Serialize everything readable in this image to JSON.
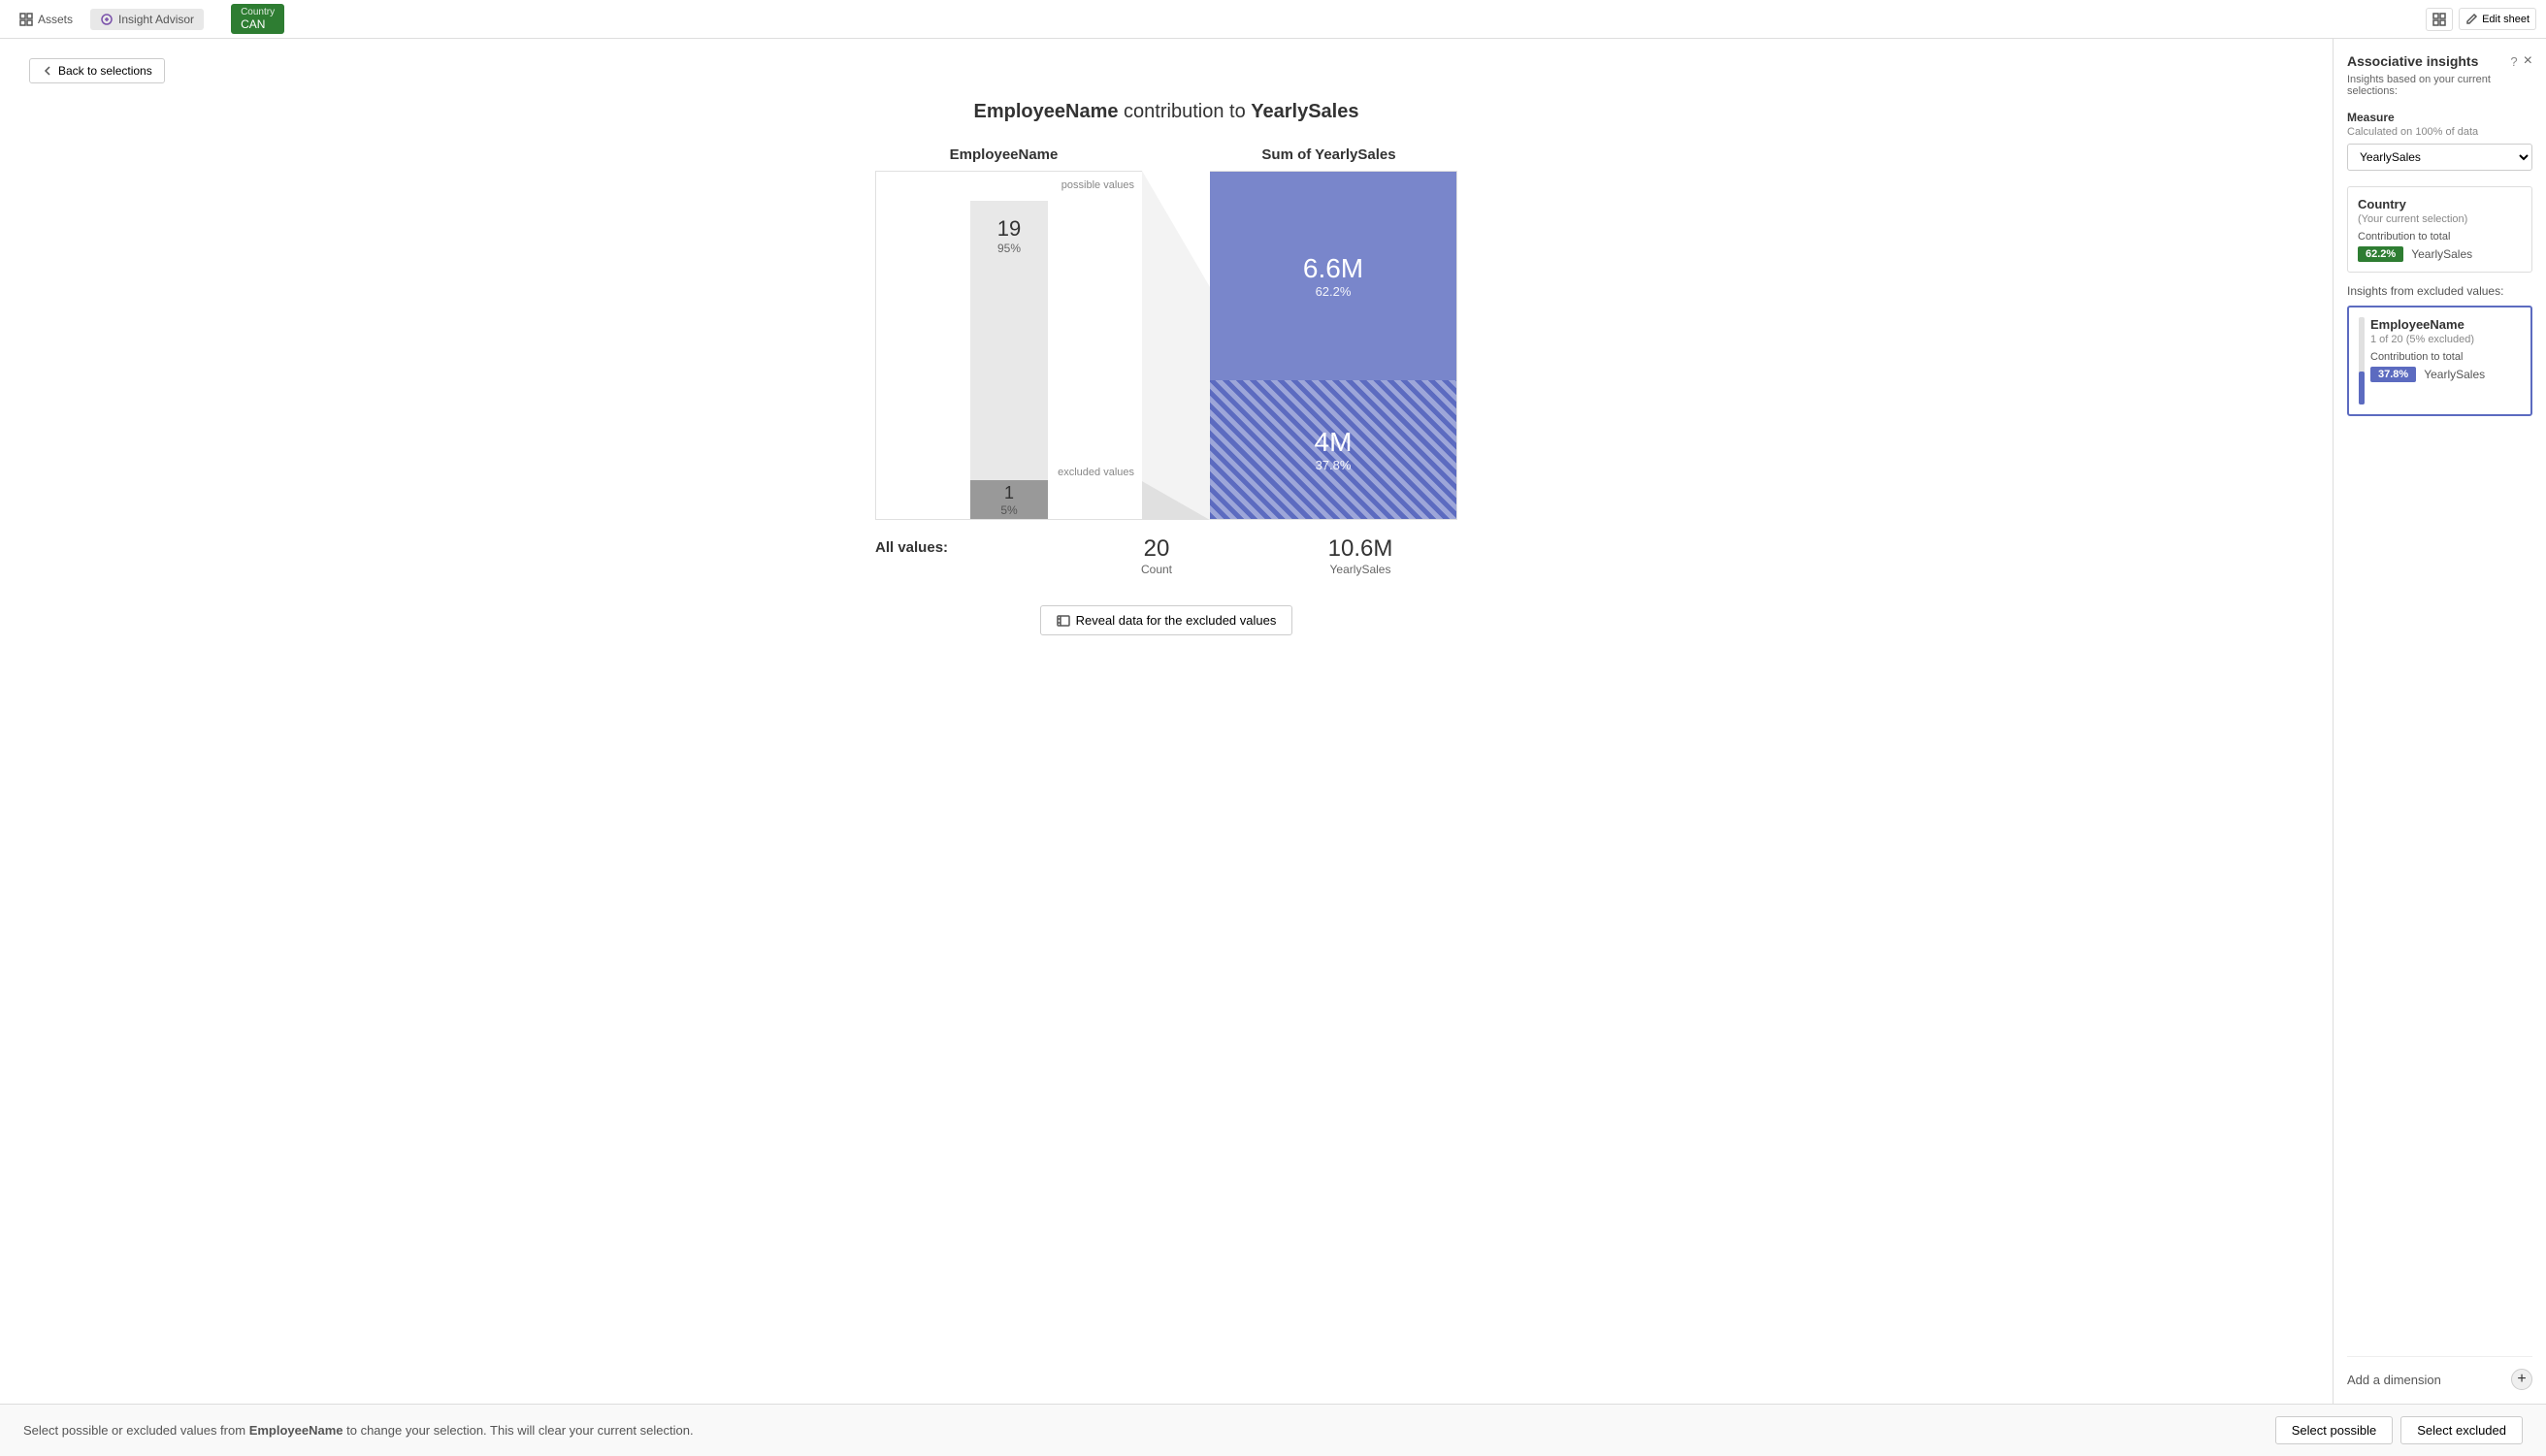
{
  "topbar": {
    "assets_label": "Assets",
    "insight_advisor_label": "Insight Advisor",
    "selection_field": "Country",
    "selection_value": "CAN",
    "edit_sheet_label": "Edit sheet"
  },
  "back_button": "Back to selections",
  "page_title_part1": "EmployeeName",
  "page_title_middle": " contribution to ",
  "page_title_part2": "YearlySales",
  "chart": {
    "left_header": "EmployeeName",
    "right_header": "Sum of YearlySales",
    "possible_label": "possible values",
    "excluded_label": "excluded values",
    "possible_count": "19",
    "possible_pct": "95%",
    "excluded_count": "1",
    "excluded_pct": "5%",
    "possible_sales": "6.6M",
    "possible_sales_pct": "62.2%",
    "excluded_sales": "4M",
    "excluded_sales_pct": "37.8%"
  },
  "all_values": {
    "label": "All values:",
    "count_num": "20",
    "count_label": "Count",
    "sales_num": "10.6M",
    "sales_label": "YearlySales"
  },
  "reveal_button": "Reveal data for the excluded values",
  "bottom_bar": {
    "text_prefix": "Select possible or excluded values from ",
    "field_name": "EmployeeName",
    "text_suffix": " to change your selection. This will clear your current selection.",
    "select_possible": "Select possible",
    "select_excluded": "Select excluded"
  },
  "right_panel": {
    "title": "Associative insights",
    "subtitle": "Insights based on your current selections:",
    "measure_label": "Measure",
    "measure_sub": "Calculated on 100% of data",
    "measure_dropdown": "YearlySales",
    "country_card": {
      "title": "Country",
      "subtitle": "(Your current selection)",
      "contrib_label": "Contribution to total",
      "badge": "62.2%",
      "measure": "YearlySales"
    },
    "insights_excluded_title": "Insights from excluded values:",
    "employee_card": {
      "title": "EmployeeName",
      "subtitle": "1 of 20 (5% excluded)",
      "contrib_label": "Contribution to total",
      "badge": "37.8%",
      "measure": "YearlySales"
    },
    "add_dimension_label": "Add a dimension"
  }
}
